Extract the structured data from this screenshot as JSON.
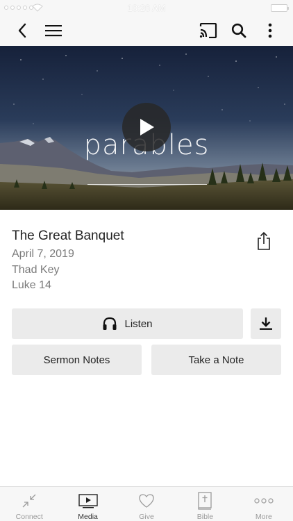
{
  "status_bar": {
    "time": "10:26 AM"
  },
  "nav": {
    "back_icon": "chevron-left-icon",
    "menu_icon": "hamburger-menu-icon",
    "cast_icon": "cast-icon",
    "search_icon": "search-icon",
    "more_icon": "vertical-ellipsis-icon"
  },
  "hero": {
    "series_title": "parables",
    "play_icon": "play-icon"
  },
  "sermon": {
    "title": "The Great Banquet",
    "date": "April 7, 2019",
    "speaker": "Thad Key",
    "scripture": "Luke 14"
  },
  "actions": {
    "listen_label": "Listen",
    "sermon_notes_label": "Sermon Notes",
    "take_note_label": "Take a Note"
  },
  "tabs": [
    {
      "label": "Connect",
      "icon": "connect-arrows-icon",
      "active": false
    },
    {
      "label": "Media",
      "icon": "media-play-icon",
      "active": true
    },
    {
      "label": "Give",
      "icon": "heart-icon",
      "active": false
    },
    {
      "label": "Bible",
      "icon": "bible-book-icon",
      "active": false
    },
    {
      "label": "More",
      "icon": "more-dots-icon",
      "active": false
    }
  ],
  "colors": {
    "bar_background": "#f7f7f7",
    "button_background": "#ebebeb",
    "meta_text": "#7a7a7a"
  }
}
